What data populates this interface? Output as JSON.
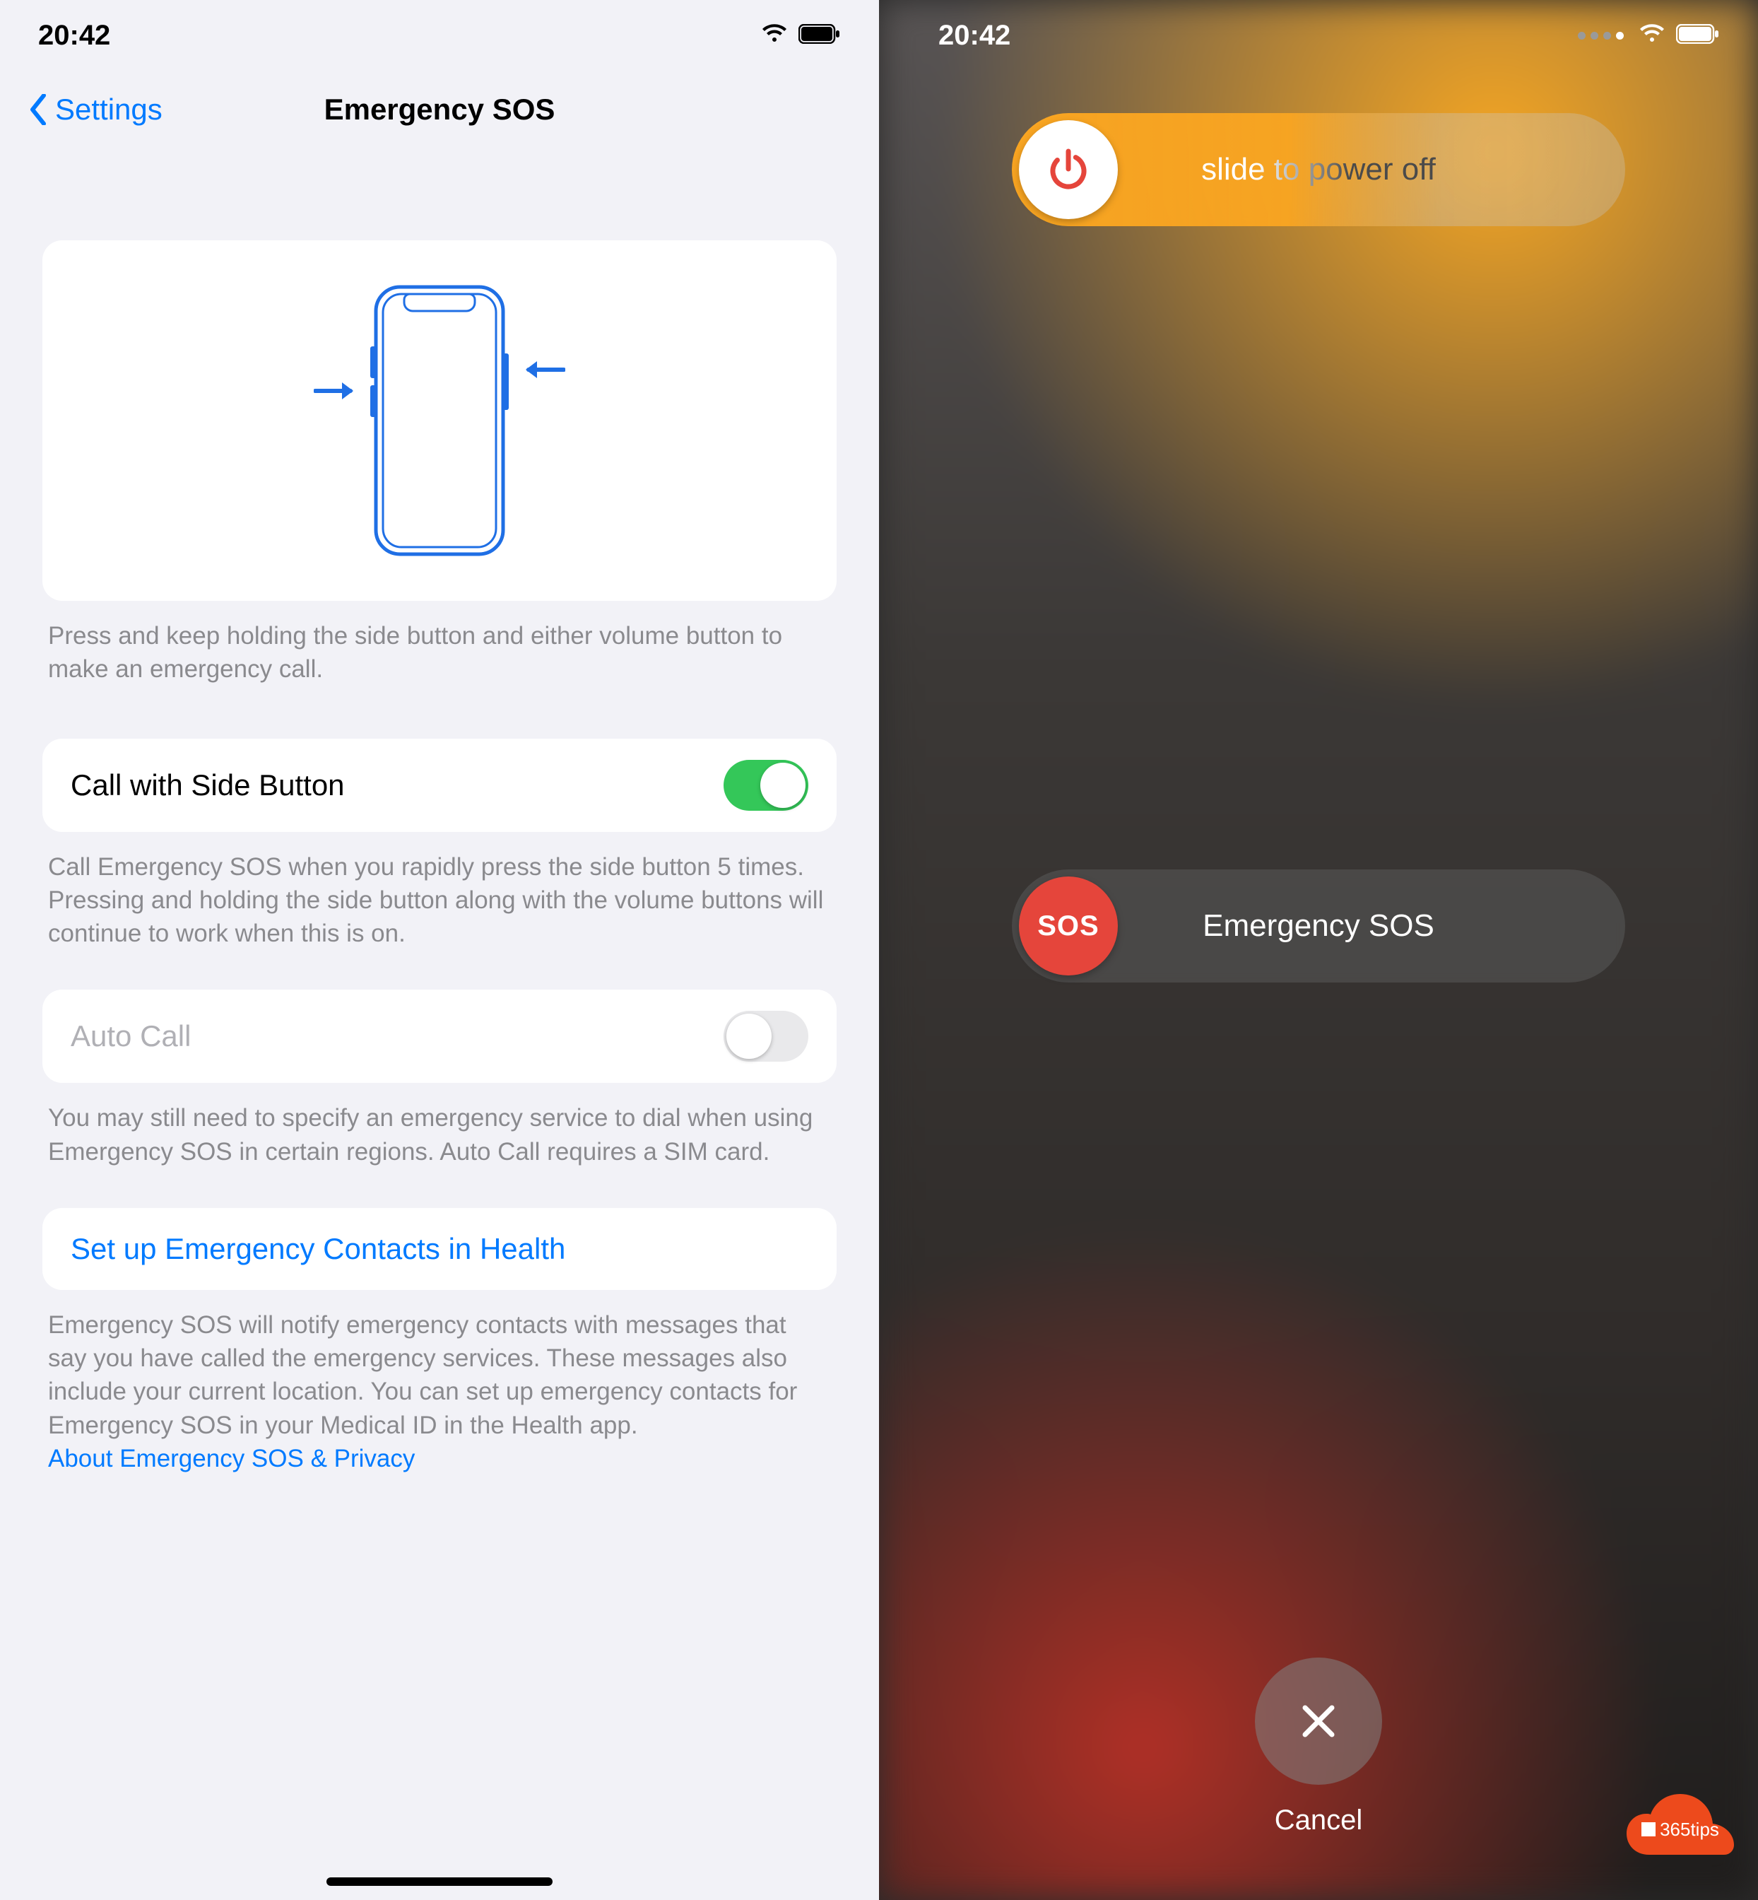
{
  "left": {
    "status": {
      "time": "20:42"
    },
    "nav": {
      "back": "Settings",
      "title": "Emergency SOS"
    },
    "illustration_footer": "Press and keep holding the side button and either volume button to make an emergency call.",
    "call_side": {
      "label": "Call with Side Button",
      "on": true,
      "footer": "Call Emergency SOS when you rapidly press the side button 5 times. Pressing and holding the side button along with the volume buttons will continue to work when this is on."
    },
    "auto_call": {
      "label": "Auto Call",
      "on": false,
      "footer": "You may still need to specify an emergency service to dial when using Emergency SOS in certain regions. Auto Call requires a SIM card."
    },
    "setup_link": "Set up Emergency Contacts in Health",
    "contacts_footer": "Emergency SOS will notify emergency contacts with messages that say you have called the emergency services. These messages also include your current location. You can set up emergency contacts for Emergency SOS in your Medical ID in the Health app.",
    "privacy_link": "About Emergency SOS & Privacy"
  },
  "right": {
    "status": {
      "time": "20:42"
    },
    "power_text": "slide to power off",
    "sos_text": "Emergency SOS",
    "sos_thumb": "SOS",
    "cancel": "Cancel"
  },
  "watermark": "365tips"
}
